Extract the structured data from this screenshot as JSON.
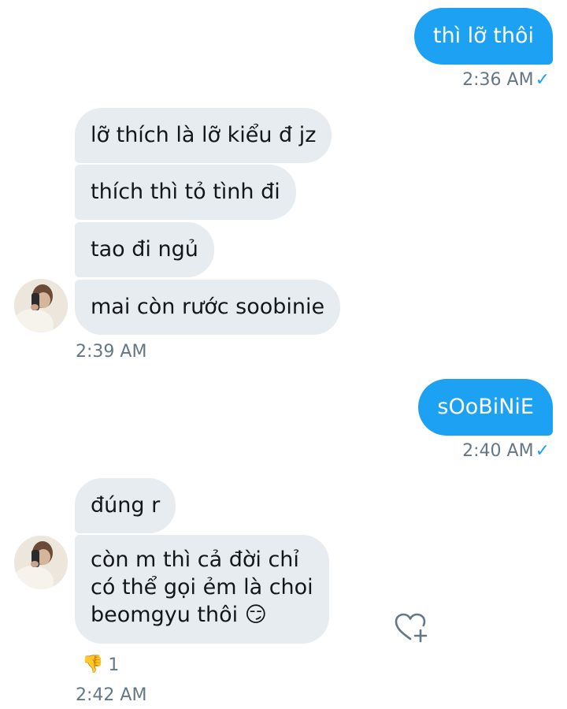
{
  "messages": {
    "m1": {
      "text": "thì lỡ thôi",
      "time": "2:36 AM"
    },
    "group1": {
      "lines": [
        "lỡ thích là lỡ kiểu đ jz",
        "thích thì tỏ tình đi",
        "tao đi ngủ",
        "mai còn rước soobinie"
      ],
      "time": "2:39 AM"
    },
    "m2": {
      "text": "sOoBiNiE",
      "time": "2:40 AM"
    },
    "group2": {
      "line1": "đúng r",
      "multi": [
        "còn m thì cả đời chỉ",
        "có thể gọi ẻm là choi",
        "beomgyu thôi"
      ],
      "emoji": "😏",
      "reaction": {
        "emoji": "👎",
        "count": "1"
      },
      "time": "2:42 AM"
    }
  },
  "read_check": "✓",
  "icons": {
    "react": "heart-plus-icon",
    "reaction": "thumbs-down-icon",
    "read": "check-icon"
  },
  "colors": {
    "sent_bubble": "#1da1f2",
    "received_bubble": "#e6ecf0",
    "timestamp": "#657786"
  }
}
